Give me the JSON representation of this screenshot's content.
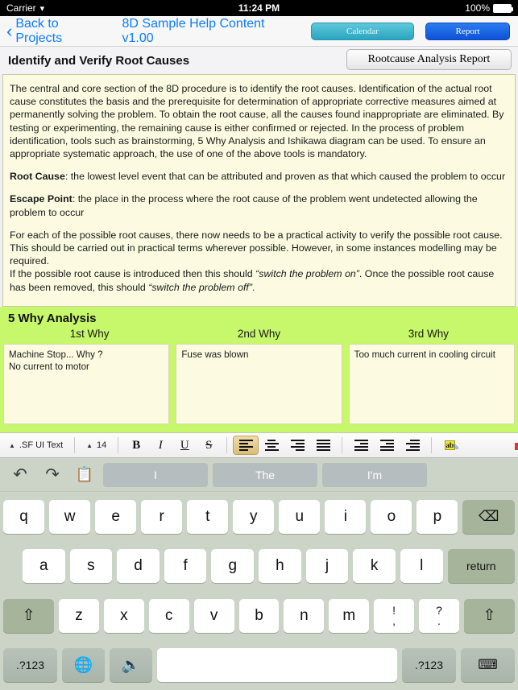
{
  "status_bar": {
    "carrier": "Carrier",
    "wifi_icon": "wifi-icon",
    "time": "11:24 PM",
    "battery_percent": "100%"
  },
  "nav_bar": {
    "back_label": "Back to Projects",
    "doc_title": "8D Sample Help Content v1.00",
    "calendar_button": "Calendar",
    "report_button": "Report"
  },
  "section": {
    "title": "Identify and Verify Root Causes",
    "report_button": "Rootcause Analysis Report"
  },
  "body": {
    "p1": "The central and core section of the 8D procedure is to identify the root causes. Identification of the actual root cause constitutes the basis and the prerequisite for determination of appropriate corrective measures aimed at permanently solving the problem. To obtain the root cause, all the causes found inappropriate are eliminated. By testing or experimenting, the remaining cause is either confirmed or rejected. In the process of problem identification, tools such as brainstorming, 5 Why Analysis and Ishikawa diagram can be used. To ensure an appropriate systematic approach, the use of one of the above tools is mandatory.",
    "root_cause_label": "Root Cause",
    "root_cause_text": ": the lowest level event that can be attributed and proven as that which caused the problem to occur",
    "escape_point_label": "Escape Point",
    "escape_point_text": ": the place in the process where the root cause of the problem went undetected allowing the problem to occur",
    "p4": "For each of the possible root causes, there now needs to be a practical activity to verify the possible root cause. This should be carried out in practical terms wherever possible. However, in some instances modelling may be required.",
    "p5a": "If the possible root cause is introduced then this should ",
    "p5b": "“switch the problem on”",
    "p5c": ". Once the possible root cause has been removed, this should ",
    "p5d": "“switch the problem off”",
    "p5e": "."
  },
  "why_section": {
    "title": "5 Why Analysis",
    "columns": [
      {
        "header": "1st Why",
        "line1": "Machine Stop... Why ?",
        "line2": "No current to motor"
      },
      {
        "header": "2nd Why",
        "line1": "Fuse was blown",
        "line2": ""
      },
      {
        "header": "3rd Why",
        "line1": "Too much current in cooling circuit",
        "line2": ""
      }
    ]
  },
  "format_toolbar": {
    "font_name": ".SF UI Text",
    "font_size": "14",
    "bold": "B",
    "italic": "I",
    "underline": "U",
    "strikethrough": "S",
    "align_left_icon": "align-left-icon",
    "align_center_icon": "align-center-icon",
    "align_right_icon": "align-right-icon",
    "align_justify_icon": "align-justify-icon",
    "outdent_icon": "outdent-icon",
    "indent_icon": "indent-icon",
    "list_icon": "list-icon",
    "spellcheck_label": "ab",
    "spellcheck_icon": "spellcheck-pen-icon"
  },
  "keyboard": {
    "undo_icon": "undo-icon",
    "redo_icon": "redo-icon",
    "paste_icon": "paste-icon",
    "predictions": [
      "I",
      "The",
      "I'm"
    ],
    "row1": [
      "q",
      "w",
      "e",
      "r",
      "t",
      "y",
      "u",
      "i",
      "o",
      "p"
    ],
    "row2": [
      "a",
      "s",
      "d",
      "f",
      "g",
      "h",
      "j",
      "k",
      "l"
    ],
    "row3": [
      "z",
      "x",
      "c",
      "v",
      "b",
      "n",
      "m"
    ],
    "punct1_top": "!",
    "punct1_bottom": ",",
    "punct2_top": "?",
    "punct2_bottom": ".",
    "backspace_icon": "backspace-icon",
    "return_label": "return",
    "shift_icon": "shift-icon",
    "numbers_label": ".?123",
    "globe_icon": "globe-icon",
    "mic_icon": "microphone-icon",
    "space_label": "",
    "hide_keyboard_icon": "hide-keyboard-icon"
  },
  "colors": {
    "accent_blue": "#0a7cff",
    "report_blue": "#1558e0",
    "calendar_teal": "#3bb4cd",
    "why_green": "#c7f76a",
    "paper_cream": "#fcfbe1",
    "keyboard_bg": "#ccd4c7"
  }
}
